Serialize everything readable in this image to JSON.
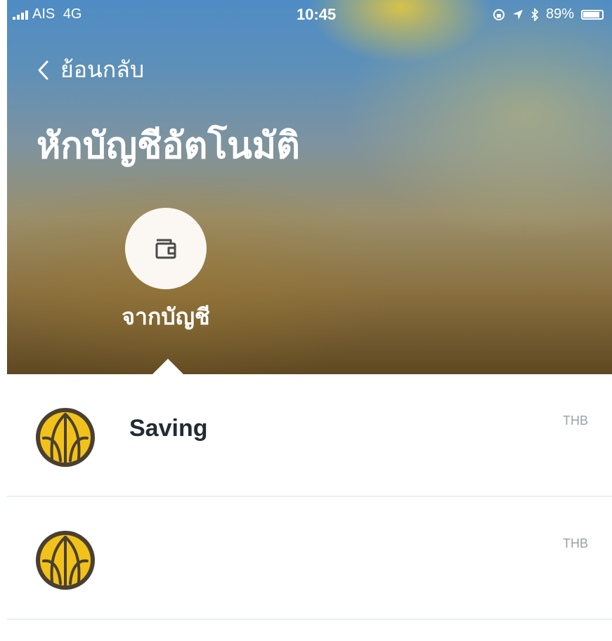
{
  "status_bar": {
    "carrier": "AIS",
    "network": "4G",
    "time": "10:45",
    "battery": "89%",
    "battery_level": 0.89
  },
  "nav": {
    "back_label": "ย้อนกลับ"
  },
  "page": {
    "title": "หักบัญชีอัตโนมัติ"
  },
  "tabs": [
    {
      "label": "จากบัญชี",
      "icon": "wallet-icon",
      "selected": true
    }
  ],
  "accounts": [
    {
      "name": "Saving",
      "currency": "THB",
      "icon": "bank-logo-icon"
    },
    {
      "name": "",
      "currency": "THB",
      "icon": "bank-logo-icon"
    }
  ],
  "colors": {
    "header_top": "#4f8cc5",
    "header_bottom": "#5e4822",
    "logo_yellow": "#f2c21a",
    "logo_dark": "#4a3f30",
    "text_dark": "#222a33",
    "text_muted": "#9aa1a8",
    "divider": "#eaf0f5"
  }
}
